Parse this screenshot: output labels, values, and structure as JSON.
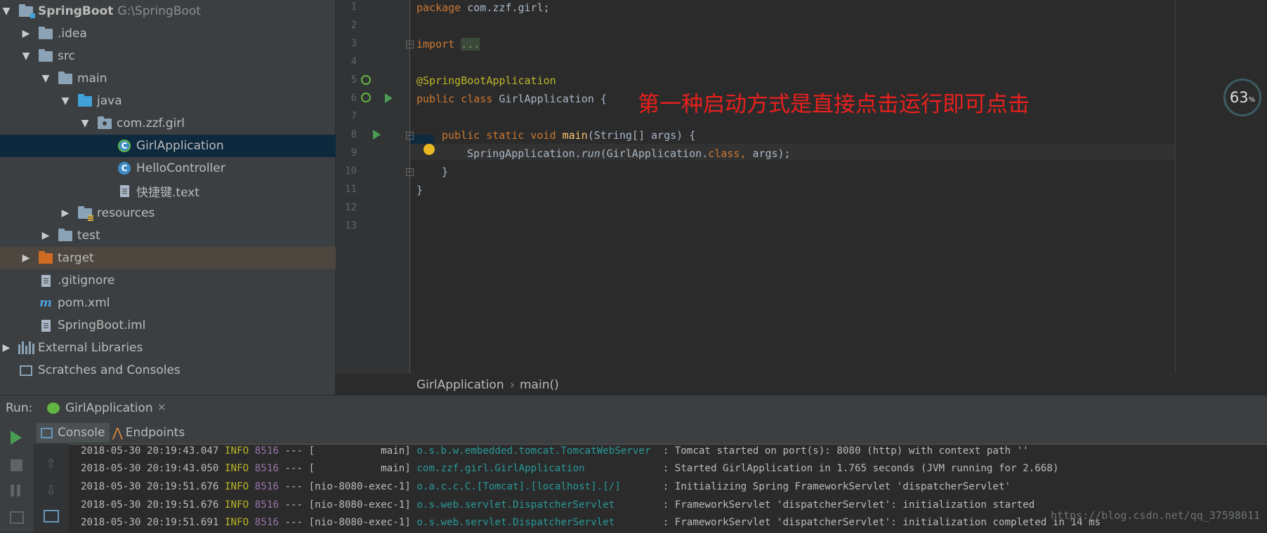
{
  "project_tree": {
    "root": {
      "label": "SpringBoot",
      "path": "G:\\SpringBoot"
    },
    "items": [
      {
        "label": ".idea"
      },
      {
        "label": "src"
      },
      {
        "label": "main"
      },
      {
        "label": "java"
      },
      {
        "label": "com.zzf.girl"
      },
      {
        "label": "GirlApplication"
      },
      {
        "label": "HelloController"
      },
      {
        "label": "快捷键.text"
      },
      {
        "label": "resources"
      },
      {
        "label": "test"
      },
      {
        "label": "target"
      },
      {
        "label": ".gitignore"
      },
      {
        "label": "pom.xml"
      },
      {
        "label": "SpringBoot.iml"
      },
      {
        "label": "External Libraries"
      },
      {
        "label": "Scratches and Consoles"
      }
    ]
  },
  "editor": {
    "line_numbers": [
      "1",
      "2",
      "3",
      "4",
      "5",
      "6",
      "7",
      "8",
      "9",
      "10",
      "11",
      "12",
      "13"
    ],
    "lines": {
      "l1_kw": "package",
      "l1_rest": " com.zzf.girl;",
      "l3_kw": "import",
      "l3_fold": "...",
      "l6_ann": "@SpringBootApplication",
      "l7_kw": "public class",
      "l7_rest": " GirlApplication {",
      "l9_kw": "public static void",
      "l9_fn": " main",
      "l9_rest": "(String[] args) {",
      "l10_obj": "SpringApplication.",
      "l10_call": "run",
      "l10_a": "(GirlApplication.",
      "l10_kw": "class,",
      "l10_b": " args);",
      "l11": "}",
      "l12": "}"
    },
    "annotation_note": "第一种启动方式是直接点击运行即可点击",
    "meter_value": "63",
    "meter_unit": "%"
  },
  "breadcrumb": {
    "items": [
      "GirlApplication",
      "main()"
    ],
    "separator": "›"
  },
  "run_panel": {
    "label": "Run:",
    "config": "GirlApplication",
    "tabs": [
      "Console",
      "Endpoints"
    ],
    "log_lines": [
      {
        "ts": "2018-05-30 20:19:43.047",
        "level": "INFO",
        "pid": "8516",
        "sep": "---",
        "thread": "[           main]",
        "logger": "o.s.b.w.embedded.tomcat.TomcatWebServer ",
        "msg": ": Tomcat started on port(s): 8080 (http) with context path ''"
      },
      {
        "ts": "2018-05-30 20:19:43.050",
        "level": "INFO",
        "pid": "8516",
        "sep": "---",
        "thread": "[           main]",
        "logger": "com.zzf.girl.GirlApplication            ",
        "msg": ": Started GirlApplication in 1.765 seconds (JVM running for 2.668)"
      },
      {
        "ts": "2018-05-30 20:19:51.676",
        "level": "INFO",
        "pid": "8516",
        "sep": "---",
        "thread": "[nio-8080-exec-1]",
        "logger": "o.a.c.c.C.[Tomcat].[localhost].[/]      ",
        "msg": ": Initializing Spring FrameworkServlet 'dispatcherServlet'"
      },
      {
        "ts": "2018-05-30 20:19:51.676",
        "level": "INFO",
        "pid": "8516",
        "sep": "---",
        "thread": "[nio-8080-exec-1]",
        "logger": "o.s.web.servlet.DispatcherServlet       ",
        "msg": ": FrameworkServlet 'dispatcherServlet': initialization started"
      },
      {
        "ts": "2018-05-30 20:19:51.691",
        "level": "INFO",
        "pid": "8516",
        "sep": "---",
        "thread": "[nio-8080-exec-1]",
        "logger": "o.s.web.servlet.DispatcherServlet       ",
        "msg": ": FrameworkServlet 'dispatcherServlet': initialization completed in 14 ms"
      }
    ],
    "watermark": "https://blog.csdn.net/qq_37598011"
  },
  "colors": {
    "note_red": "#e8201e",
    "selected_row": "#0d293e",
    "run_green": "#499c54"
  }
}
